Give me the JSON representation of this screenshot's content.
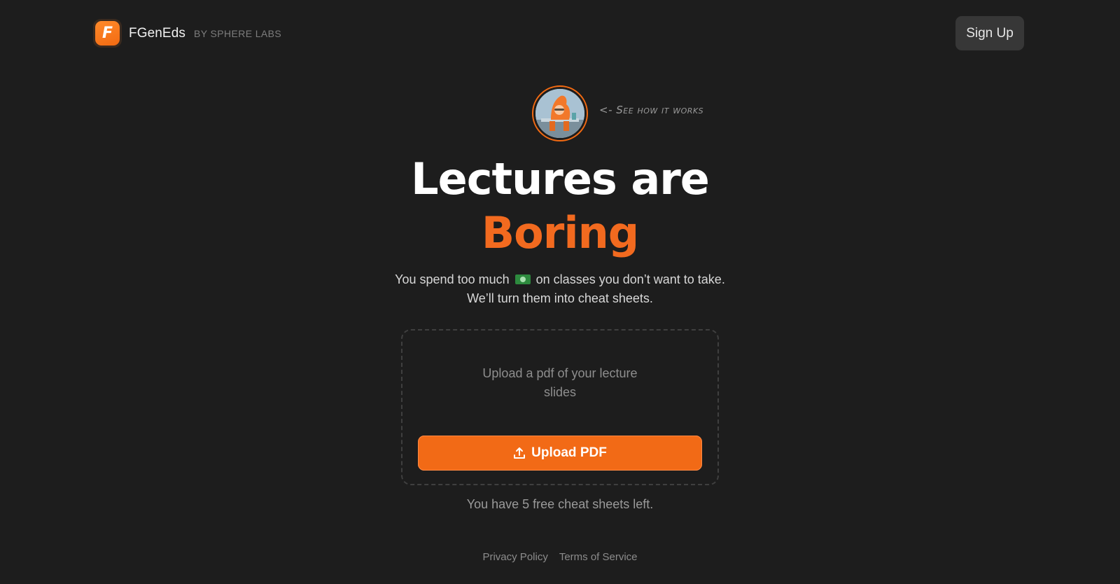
{
  "header": {
    "brand_name": "FGenEds",
    "brand_by": "BY SPHERE LABS",
    "logo_letter": "F",
    "signup_label": "Sign Up"
  },
  "hero": {
    "see_how_label": "<- See how it works",
    "title_line1": "Lectures are",
    "title_line2": "Boring",
    "subtitle_part1": "You spend too much",
    "subtitle_part2": "on classes you don’t want to take. We’ll turn them into cheat sheets."
  },
  "upload": {
    "prompt": "Upload a pdf of your lecture slides",
    "button_label": "Upload PDF",
    "free_left": "You have 5 free cheat sheets left."
  },
  "footer": {
    "privacy": "Privacy Policy",
    "terms": "Terms of Service"
  },
  "colors": {
    "accent": "#f26a16",
    "background": "#1d1d1d",
    "signup_bg": "#373737"
  },
  "icons": {
    "money": "money-bill-icon",
    "upload": "upload-icon",
    "logo": "fgeneds-logo-icon"
  }
}
